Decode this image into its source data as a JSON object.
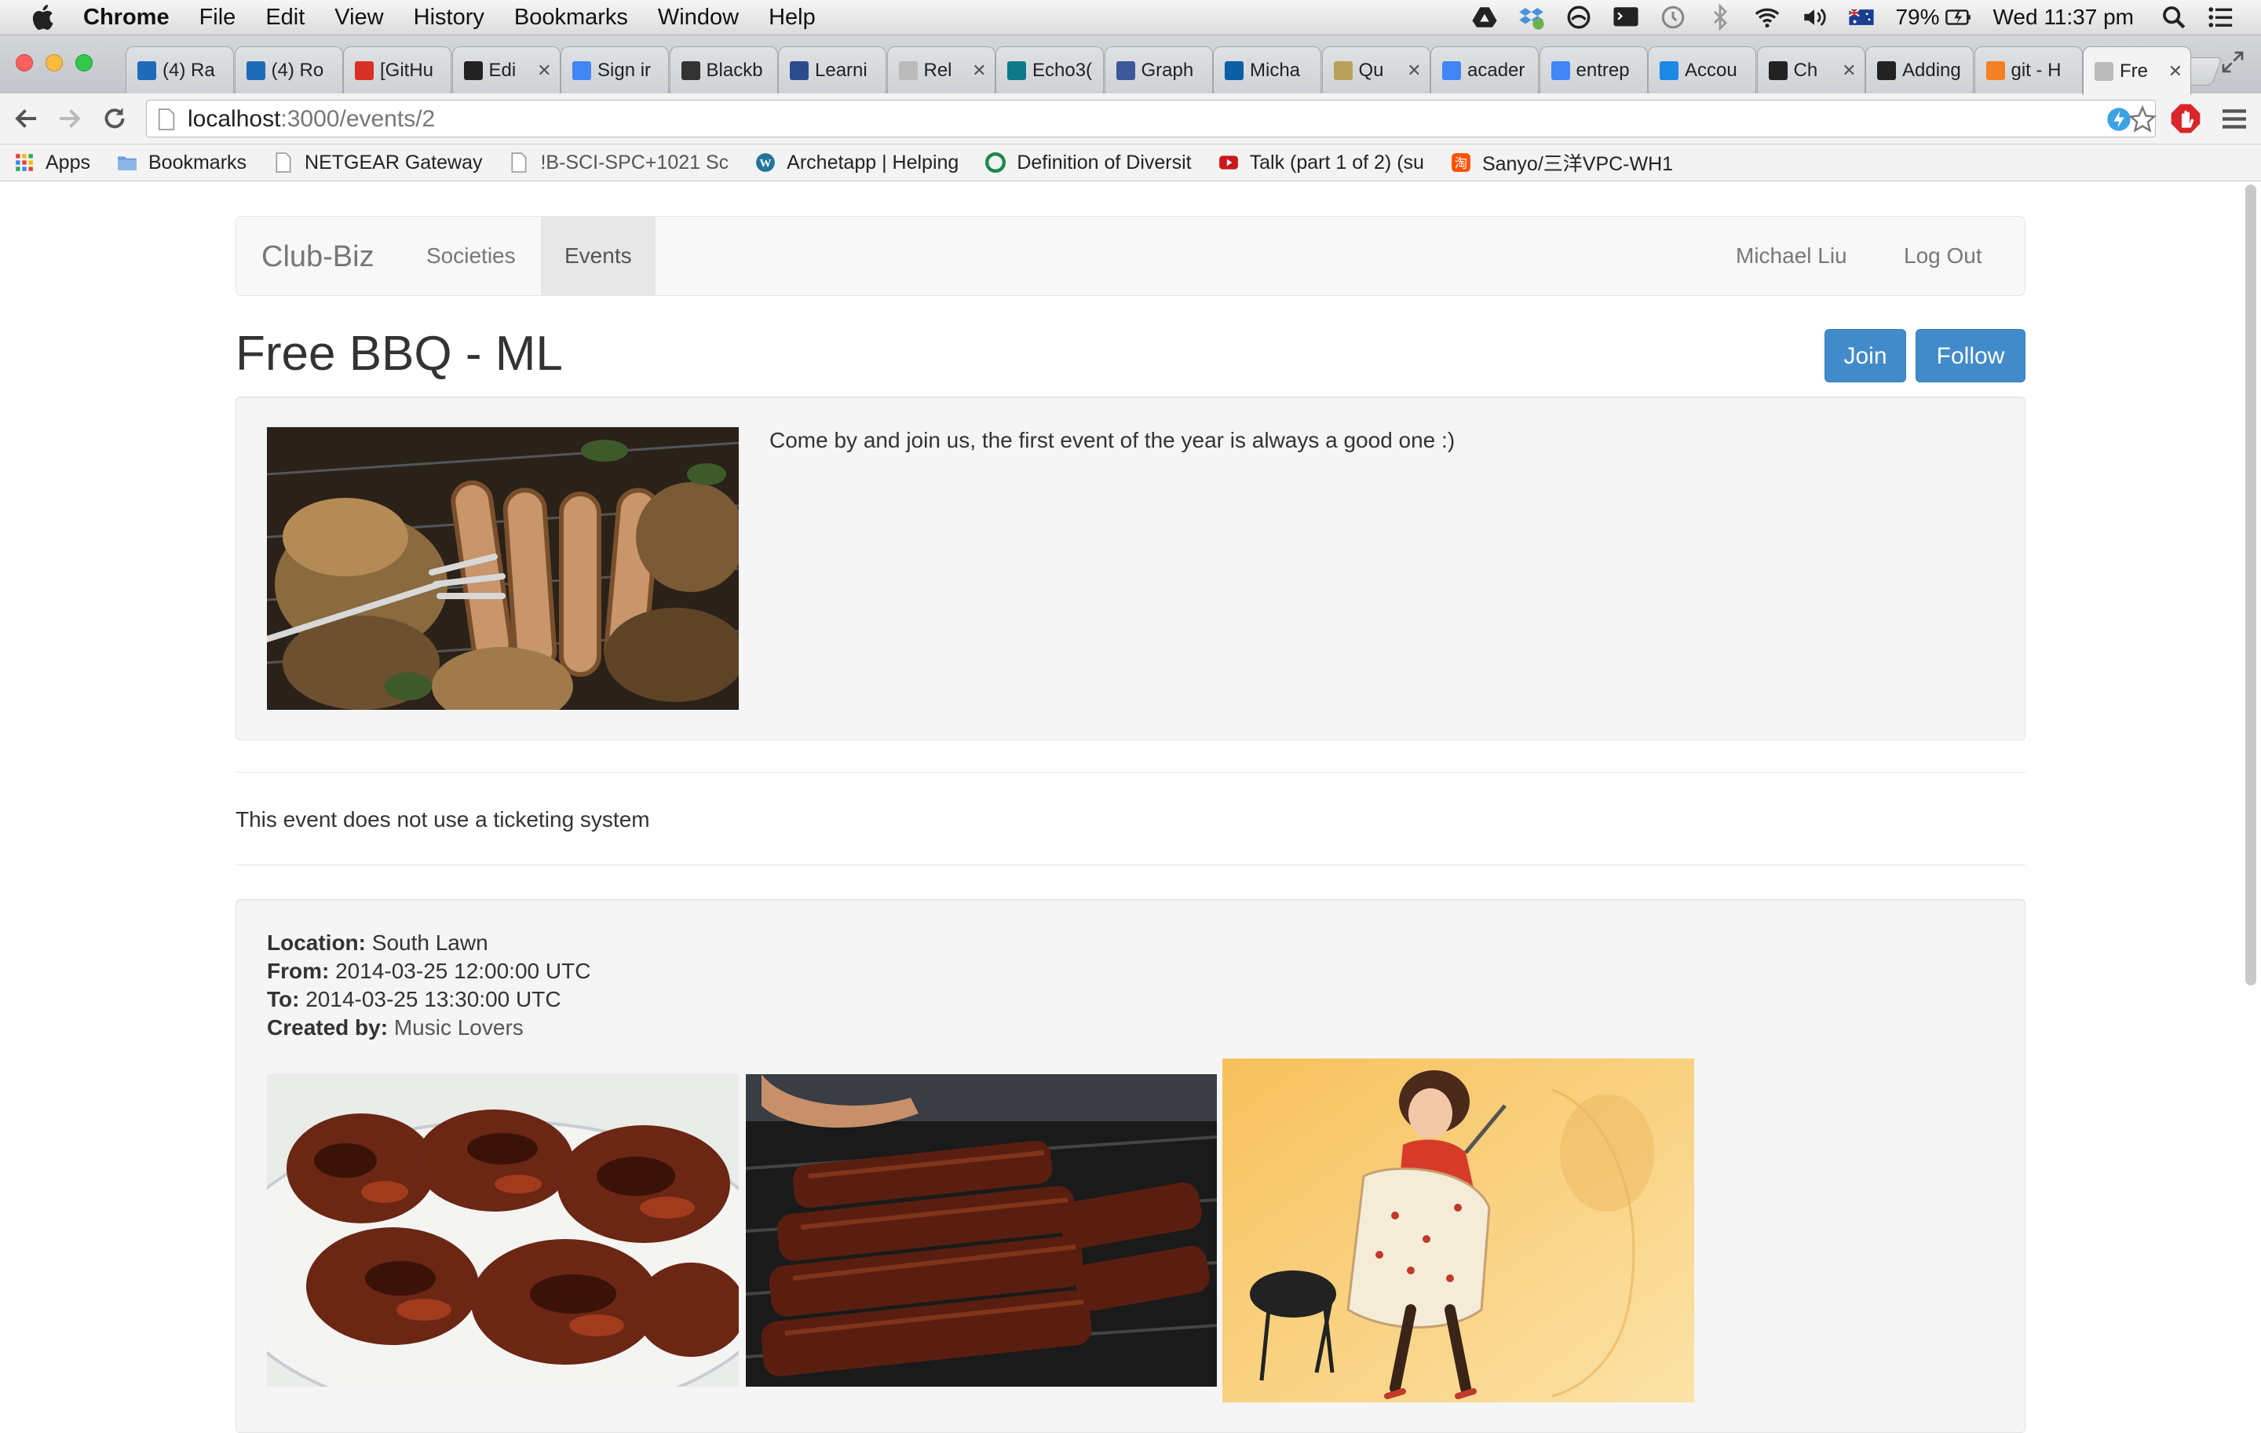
{
  "menubar": {
    "app": "Chrome",
    "items": [
      "File",
      "Edit",
      "View",
      "History",
      "Bookmarks",
      "Window",
      "Help"
    ],
    "battery": "79%",
    "clock": "Wed 11:37 pm"
  },
  "tabs": [
    {
      "title": "(4) Ra",
      "icon": "trello-icon",
      "color": "#1e6bb8"
    },
    {
      "title": "(4) Ro",
      "icon": "trello-icon",
      "color": "#1e6bb8"
    },
    {
      "title": "[GitHu",
      "icon": "gmail-icon",
      "color": "#d93025"
    },
    {
      "title": "Edi",
      "icon": "github-icon",
      "color": "#222222"
    },
    {
      "title": "Sign ir",
      "icon": "google-icon",
      "color": "#4285f4"
    },
    {
      "title": "Blackb",
      "icon": "blackboard-icon",
      "color": "#333333"
    },
    {
      "title": "Learni",
      "icon": "university-icon",
      "color": "#2a4c8c"
    },
    {
      "title": "Rel",
      "icon": "page-icon",
      "color": "#bbbbbb"
    },
    {
      "title": "Echo3(",
      "icon": "echo-icon",
      "color": "#0d7a8a"
    },
    {
      "title": "Graph",
      "icon": "facebook-icon",
      "color": "#3b5998"
    },
    {
      "title": "Micha",
      "icon": "aboutme-icon",
      "color": "#0b5fa5"
    },
    {
      "title": "Qu",
      "icon": "quora-icon",
      "color": "#b8a15a"
    },
    {
      "title": "acader",
      "icon": "google-icon",
      "color": "#4285f4"
    },
    {
      "title": "entrep",
      "icon": "google-icon",
      "color": "#4285f4"
    },
    {
      "title": "Accou",
      "icon": "telstra-icon",
      "color": "#1e88e5"
    },
    {
      "title": "Ch",
      "icon": "github-icon",
      "color": "#222222"
    },
    {
      "title": "Adding",
      "icon": "github-icon",
      "color": "#222222"
    },
    {
      "title": "git - H",
      "icon": "stackoverflow-icon",
      "color": "#f48024"
    },
    {
      "title": "Fre",
      "icon": "page-icon",
      "color": "#bbbbbb",
      "active": true
    }
  ],
  "omnibox": {
    "host": "localhost",
    "path": ":3000/events/2"
  },
  "bookmarks": [
    {
      "label": "Apps",
      "icon": "apps-icon"
    },
    {
      "label": "Bookmarks",
      "icon": "folder-icon"
    },
    {
      "label": "NETGEAR Gateway",
      "icon": "page-icon"
    },
    {
      "label": "!B-SCI-SPC+1021 Sc",
      "icon": "page-icon"
    },
    {
      "label": "Archetapp | Helping",
      "icon": "wordpress-icon"
    },
    {
      "label": "Definition of Diversit",
      "icon": "circle-icon"
    },
    {
      "label": "Talk (part 1 of 2) (su",
      "icon": "youtube-icon"
    },
    {
      "label": "Sanyo/三洋VPC-WH1",
      "icon": "taobao-icon"
    }
  ],
  "navbar": {
    "brand": "Club-Biz",
    "links": [
      "Societies",
      "Events"
    ],
    "active": "Events",
    "user": "Michael Liu",
    "logout": "Log Out"
  },
  "event": {
    "title": "Free BBQ - ML",
    "join_label": "Join",
    "follow_label": "Follow",
    "description": "Come by and join us, the first event of the year is always a good one :)",
    "ticketing": "This event does not use a ticketing system",
    "location_label": "Location:",
    "location": "South Lawn",
    "from_label": "From:",
    "from": "2014-03-25 12:00:00 UTC",
    "to_label": "To:",
    "to": "2014-03-25 13:30:00 UTC",
    "created_label": "Created by:",
    "created_by": "Music Lovers"
  },
  "colors": {
    "primary": "#428bca",
    "well_bg": "#f5f5f5",
    "navbar_bg": "#f8f8f8"
  }
}
